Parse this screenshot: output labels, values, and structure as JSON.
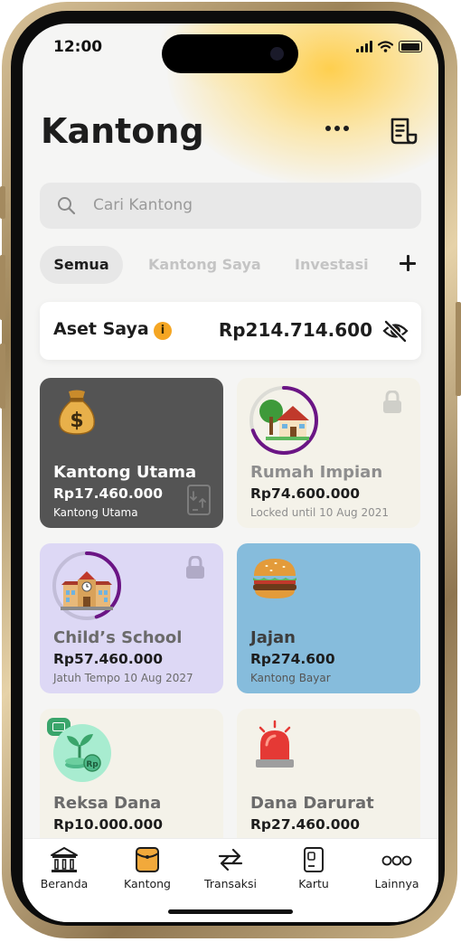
{
  "status_bar": {
    "time": "12:00"
  },
  "header": {
    "title": "Kantong",
    "more_icon": "more-horizontal-icon",
    "receipt_icon": "receipt-icon"
  },
  "search": {
    "placeholder": "Cari Kantong",
    "icon": "search-icon"
  },
  "tabs": [
    {
      "label": "Semua",
      "active": true
    },
    {
      "label": "Kantong Saya",
      "active": false
    },
    {
      "label": "Investasi",
      "active": false
    }
  ],
  "aset": {
    "label": "Aset Saya",
    "value": "Rp214.714.600",
    "info_icon": "i"
  },
  "pockets": [
    {
      "name": "Kantong Utama",
      "amount": "Rp17.460.000",
      "sub": "Kantong Utama",
      "color": "#545454",
      "icon": "money-bag-icon"
    },
    {
      "name": "Rumah Impian",
      "amount": "Rp74.600.000",
      "sub": "Locked until 10 Aug 2021",
      "color": "#f4f2e9",
      "icon": "house-icon",
      "progress": 0.7,
      "locked": true
    },
    {
      "name": "Child’s School",
      "amount": "Rp57.460.000",
      "sub": "Jatuh Tempo 10 Aug 2027",
      "color": "#ddd8f5",
      "icon": "school-icon",
      "progress": 0.45,
      "locked": true
    },
    {
      "name": "Jajan",
      "amount": "Rp274.600",
      "sub": "Kantong Bayar",
      "color": "#86bcdc",
      "icon": "burger-icon"
    },
    {
      "name": "Reksa Dana",
      "amount": "Rp10.000.000",
      "sub": "",
      "color": "#f4f2e9",
      "icon": "investment-plant-icon"
    },
    {
      "name": "Dana Darurat",
      "amount": "Rp27.460.000",
      "sub": "",
      "color": "#f4f2e9",
      "icon": "siren-icon"
    }
  ],
  "nav": [
    {
      "label": "Beranda",
      "icon": "bank-icon"
    },
    {
      "label": "Kantong",
      "icon": "pocket-icon",
      "active": true
    },
    {
      "label": "Transaksi",
      "icon": "transfer-icon"
    },
    {
      "label": "Kartu",
      "icon": "card-icon"
    },
    {
      "label": "Lainnya",
      "icon": "more-icon"
    }
  ],
  "colors": {
    "accent_ring": "#6b1585",
    "info": "#f5a623",
    "active_nav": "#f2a93b"
  }
}
